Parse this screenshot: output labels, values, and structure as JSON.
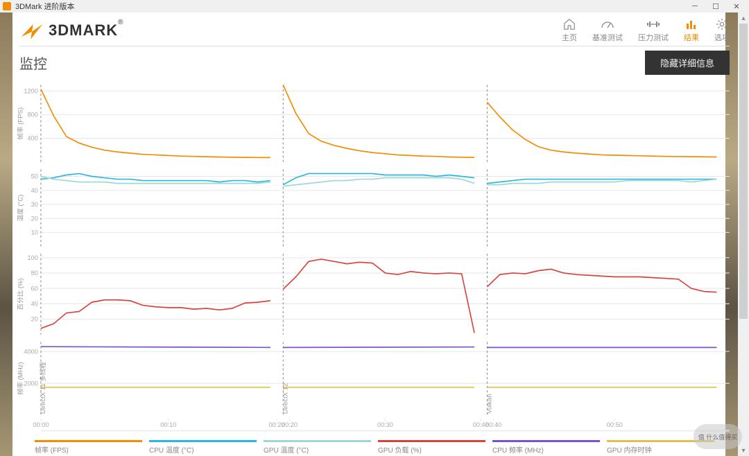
{
  "window": {
    "title": "3DMark 进阶版本"
  },
  "brand": {
    "name": "3DMARK"
  },
  "nav": {
    "home": "主页",
    "benchmark": "基准测试",
    "stress": "压力测试",
    "results": "结果",
    "options": "选项"
  },
  "section": {
    "title": "监控",
    "hide_btn": "隐藏详细信息"
  },
  "legend": {
    "fps": "帧率 (FPS)",
    "cpu_temp": "CPU 温度 (°C)",
    "gpu_temp": "GPU 温度 (°C)",
    "gpu_load": "GPU 负载 (%)",
    "cpu_freq": "CPU 频率 (MHz)",
    "gpu_mem": "GPU 内存时钟"
  },
  "colors": {
    "fps": "#f28c00",
    "cpu_temp": "#2ab7e0",
    "gpu_temp": "#9dd9d2",
    "gpu_load": "#d9433e",
    "cpu_freq": "#7c52c7",
    "gpu_memclk": "#e0c24a"
  },
  "axes": {
    "fps_label": "帧率 (FPS)",
    "temp_label": "温度 (°C)",
    "pct_label": "百分比 (%)",
    "freq_label": "频率 (MHz)",
    "segments": [
      "DirectX 11 多线程",
      "DirectX 12",
      "Vulkan"
    ]
  },
  "chart_data": [
    {
      "type": "line",
      "title": "帧率 (FPS)",
      "ylabel": "帧率 (FPS)",
      "ylim": [
        0,
        1300
      ],
      "yticks": [
        400,
        800,
        1200
      ],
      "xlabel": "",
      "xlim": [
        0,
        54
      ],
      "xticks": [
        "00:00",
        "00:10",
        "00:20",
        "00:20",
        "00:30",
        "00:40",
        "00:40",
        "00:50"
      ],
      "series": [
        {
          "name": "帧率 (FPS)",
          "color": "#f28c00",
          "segments": [
            {
              "label": "DirectX 11",
              "x": [
                0,
                1,
                2,
                3,
                4,
                5,
                6,
                7,
                8,
                9,
                10,
                11,
                12,
                13,
                14,
                15,
                16,
                17,
                18
              ],
              "y": [
                1230,
                780,
                430,
                320,
                250,
                200,
                170,
                150,
                130,
                120,
                110,
                100,
                95,
                90,
                85,
                80,
                78,
                76,
                75
              ]
            },
            {
              "label": "DirectX 12",
              "x": [
                19,
                20,
                21,
                22,
                23,
                24,
                25,
                26,
                27,
                28,
                29,
                30,
                31,
                32,
                33,
                34
              ],
              "y": [
                1300,
                820,
                480,
                350,
                280,
                230,
                190,
                160,
                140,
                120,
                110,
                100,
                95,
                85,
                80,
                78
              ]
            },
            {
              "label": "Vulkan",
              "x": [
                35,
                36,
                37,
                38,
                39,
                40,
                41,
                42,
                43,
                44,
                45,
                46,
                47,
                48,
                49,
                50,
                51,
                52,
                53
              ],
              "y": [
                1010,
                760,
                540,
                380,
                260,
                200,
                170,
                150,
                135,
                120,
                115,
                110,
                105,
                100,
                95,
                92,
                90,
                88,
                85
              ]
            }
          ]
        }
      ]
    },
    {
      "type": "line",
      "title": "温度 (°C)",
      "ylabel": "温度 (°C)",
      "ylim": [
        0,
        55
      ],
      "yticks": [
        10,
        20,
        30,
        40,
        50
      ],
      "series": [
        {
          "name": "CPU 温度 (°C)",
          "color": "#2ab7e0",
          "segments": [
            {
              "label": "DirectX 11",
              "x": [
                0,
                1,
                2,
                3,
                4,
                5,
                6,
                7,
                8,
                9,
                10,
                11,
                12,
                13,
                14,
                15,
                16,
                17,
                18
              ],
              "y": [
                48,
                49,
                51,
                52,
                50,
                49,
                48,
                48,
                47,
                47,
                47,
                47,
                47,
                47,
                46,
                47,
                47,
                46,
                47
              ]
            },
            {
              "label": "DirectX 12",
              "x": [
                19,
                20,
                21,
                22,
                23,
                24,
                25,
                26,
                27,
                28,
                29,
                30,
                31,
                32,
                33,
                34
              ],
              "y": [
                44,
                49,
                52,
                52,
                52,
                52,
                52,
                52,
                51,
                51,
                51,
                51,
                50,
                51,
                50,
                49
              ]
            },
            {
              "label": "Vulkan",
              "x": [
                35,
                36,
                37,
                38,
                39,
                40,
                41,
                42,
                43,
                44,
                45,
                46,
                47,
                48,
                49,
                50,
                51,
                52,
                53
              ],
              "y": [
                45,
                46,
                47,
                48,
                48,
                48,
                48,
                48,
                48,
                48,
                48,
                48,
                48,
                48,
                48,
                48,
                48,
                48,
                48
              ]
            }
          ]
        },
        {
          "name": "GPU 温度 (°C)",
          "color": "#9dd9d2",
          "segments": [
            {
              "label": "DirectX 11",
              "x": [
                0,
                1,
                2,
                3,
                4,
                5,
                6,
                7,
                8,
                9,
                10,
                11,
                12,
                13,
                14,
                15,
                16,
                17,
                18
              ],
              "y": [
                50,
                48,
                47,
                46,
                46,
                46,
                45,
                45,
                45,
                45,
                45,
                45,
                45,
                45,
                45,
                45,
                45,
                45,
                46
              ]
            },
            {
              "label": "DirectX 12",
              "x": [
                19,
                20,
                21,
                22,
                23,
                24,
                25,
                26,
                27,
                28,
                29,
                30,
                31,
                32,
                33,
                34
              ],
              "y": [
                43,
                44,
                45,
                46,
                47,
                47,
                48,
                48,
                49,
                49,
                49,
                49,
                49,
                49,
                48,
                45
              ]
            },
            {
              "label": "Vulkan",
              "x": [
                35,
                36,
                37,
                38,
                39,
                40,
                41,
                42,
                43,
                44,
                45,
                46,
                47,
                48,
                49,
                50,
                51,
                52,
                53
              ],
              "y": [
                44,
                44,
                45,
                45,
                45,
                46,
                46,
                46,
                46,
                46,
                46,
                47,
                47,
                47,
                47,
                47,
                46,
                47,
                48
              ]
            }
          ]
        }
      ]
    },
    {
      "type": "line",
      "title": "百分比 (%)",
      "ylabel": "百分比 (%)",
      "ylim": [
        0,
        105
      ],
      "yticks": [
        20,
        40,
        60,
        80,
        100
      ],
      "series": [
        {
          "name": "GPU 负载 (%)",
          "color": "#d9433e",
          "segments": [
            {
              "label": "DirectX 11",
              "x": [
                0,
                1,
                2,
                3,
                4,
                5,
                6,
                7,
                8,
                9,
                10,
                11,
                12,
                13,
                14,
                15,
                16,
                17,
                18
              ],
              "y": [
                8,
                14,
                28,
                30,
                42,
                45,
                45,
                44,
                38,
                36,
                35,
                35,
                33,
                34,
                32,
                34,
                41,
                42,
                44
              ]
            },
            {
              "label": "DirectX 12",
              "x": [
                19,
                20,
                21,
                22,
                23,
                24,
                25,
                26,
                27,
                28,
                29,
                30,
                31,
                32,
                33,
                34
              ],
              "y": [
                59,
                75,
                95,
                98,
                95,
                92,
                94,
                93,
                80,
                78,
                82,
                80,
                79,
                80,
                79,
                2
              ]
            },
            {
              "label": "Vulkan",
              "x": [
                35,
                36,
                37,
                38,
                39,
                40,
                41,
                42,
                43,
                44,
                45,
                46,
                47,
                48,
                49,
                50,
                51,
                52,
                53
              ],
              "y": [
                62,
                78,
                80,
                79,
                83,
                85,
                80,
                78,
                77,
                76,
                75,
                75,
                75,
                74,
                73,
                72,
                60,
                56,
                55
              ]
            }
          ]
        }
      ]
    },
    {
      "type": "line",
      "title": "频率 (MHz)",
      "ylabel": "频率 (MHz)",
      "ylim": [
        0,
        4600
      ],
      "yticks": [
        2000,
        4000
      ],
      "series": [
        {
          "name": "CPU 频率 (MHz)",
          "color": "#7c52c7",
          "segments": [
            {
              "label": "DirectX 11",
              "x": [
                0,
                18
              ],
              "y": [
                4300,
                4250
              ]
            },
            {
              "label": "DirectX 12",
              "x": [
                19,
                34
              ],
              "y": [
                4250,
                4280
              ]
            },
            {
              "label": "Vulkan",
              "x": [
                35,
                53
              ],
              "y": [
                4250,
                4250
              ]
            }
          ]
        },
        {
          "name": "GPU 内存时钟",
          "color": "#e0c24a",
          "segments": [
            {
              "label": "DirectX 11",
              "x": [
                0,
                18
              ],
              "y": [
                1750,
                1750
              ]
            },
            {
              "label": "DirectX 12",
              "x": [
                19,
                34
              ],
              "y": [
                1750,
                1750
              ]
            },
            {
              "label": "Vulkan",
              "x": [
                35,
                53
              ],
              "y": [
                1750,
                1750
              ]
            }
          ]
        }
      ]
    }
  ],
  "watermark": "值 什么值得买"
}
